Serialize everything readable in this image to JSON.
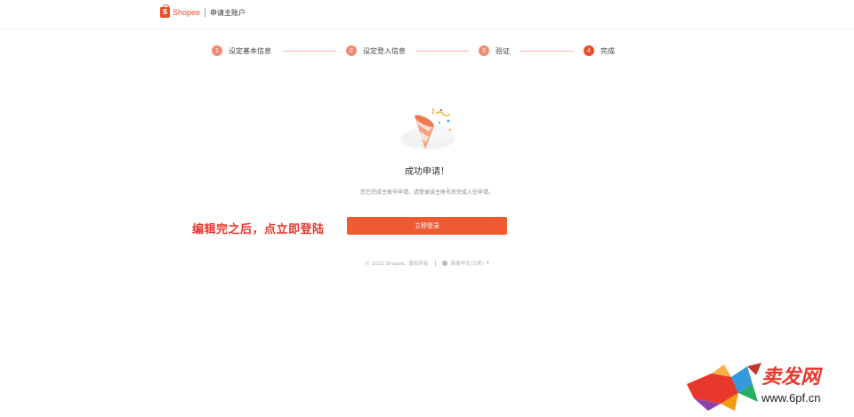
{
  "header": {
    "brand": "Shopee",
    "logo_letter": "S",
    "subtitle": "申请主账户"
  },
  "steps": [
    {
      "num": "1",
      "label": "设定基本信息"
    },
    {
      "num": "2",
      "label": "设定登入信息"
    },
    {
      "num": "3",
      "label": "验证"
    },
    {
      "num": "4",
      "label": "完成"
    }
  ],
  "main": {
    "title": "成功申请！",
    "description": "您已完成主账号申请，请登录该主账号后完成入驻申请。",
    "login_button": "立即登录",
    "annotation": "编辑完之后，点立即登陆"
  },
  "footer": {
    "copyright": "© 2022 Shopee。版权所有",
    "language": "简体中文(马来)",
    "language_caret": "▾"
  },
  "watermark": {
    "title": "卖发网",
    "url": "www.6pf.cn"
  },
  "colors": {
    "brand": "#ee4d2d",
    "step_inactive": "#f08a73",
    "button": "#f05a32"
  }
}
